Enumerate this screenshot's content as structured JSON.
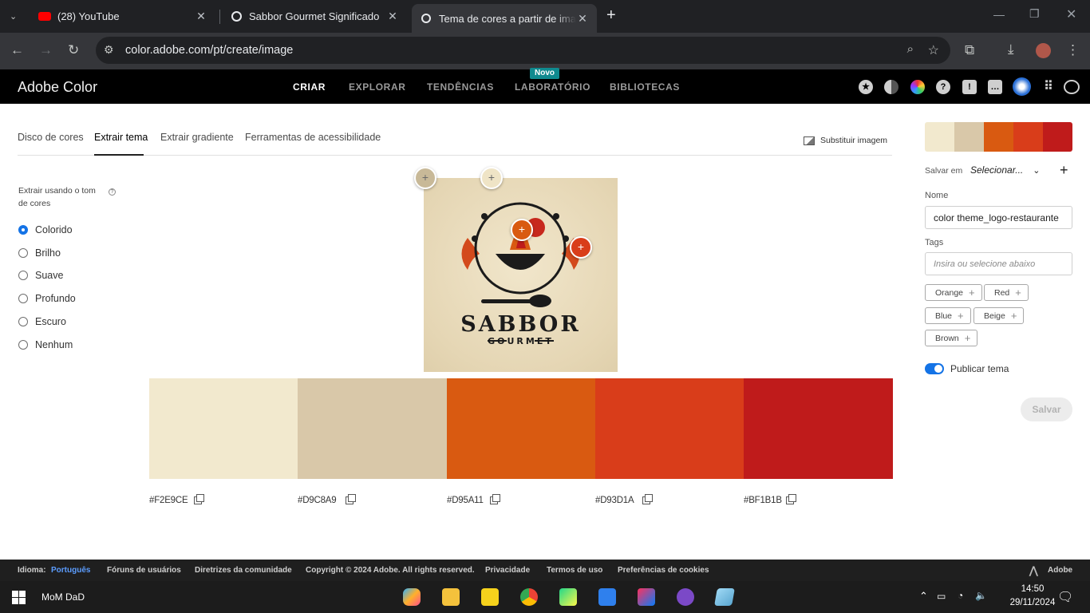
{
  "browser": {
    "tabs": [
      {
        "title": "(28) YouTube",
        "close": "✕"
      },
      {
        "title": "Sabbor Gourmet Significado",
        "close": "✕"
      },
      {
        "title": "Tema de cores a partir de image",
        "close": "✕"
      }
    ],
    "new_tab": "+",
    "url": "color.adobe.com/pt/create/image"
  },
  "app": {
    "brand": "Adobe Color",
    "nav": [
      "CRIAR",
      "EXPLORAR",
      "TENDÊNCIAS",
      "LABORATÓRIO",
      "BIBLIOTECAS"
    ],
    "novo_badge": "Novo"
  },
  "subtabs": [
    "Disco de cores",
    "Extrair tema",
    "Extrair gradiente",
    "Ferramentas de acessibilidade"
  ],
  "replace_image": "Substituir imagem",
  "mood": {
    "label": "Extrair usando o tom de cores",
    "help": "?",
    "options": [
      "Colorido",
      "Brilho",
      "Suave",
      "Profundo",
      "Escuro",
      "Nenhum"
    ],
    "selected": "Colorido"
  },
  "image": {
    "line1": "SABBOR",
    "line2": "GOURMET"
  },
  "swatches": [
    {
      "hex": "#F2E9CE",
      "color": "#F2E9CE"
    },
    {
      "hex": "#D9C8A9",
      "color": "#D9C8A9"
    },
    {
      "hex": "#D95A11",
      "color": "#D95A11"
    },
    {
      "hex": "#D93D1A",
      "color": "#D93D1A"
    },
    {
      "hex": "#BF1B1B",
      "color": "#BF1B1B"
    }
  ],
  "right_panel": {
    "save_in_label": "Salvar em",
    "save_in_value": "Selecionar...",
    "add": "+",
    "name_label": "Nome",
    "name_value": "color theme_logo-restaurante",
    "tags_label": "Tags",
    "tags_placeholder": "Insira ou selecione abaixo",
    "tags": [
      "Orange",
      "Red",
      "Blue",
      "Beige",
      "Brown"
    ],
    "publish_label": "Publicar tema",
    "publish_on": true,
    "save_button": "Salvar"
  },
  "footer": {
    "lang_label": "Idioma:",
    "lang_value": "Português",
    "links": [
      "Fóruns de usuários",
      "Diretrizes da comunidade",
      "Copyright © 2024 Adobe. All rights reserved.",
      "Privacidade",
      "Termos de uso",
      "Preferências de cookies"
    ],
    "adobe": "Adobe"
  },
  "taskbar": {
    "user": "MoM  DaD",
    "time": "14:50",
    "date": "29/11/2024"
  }
}
